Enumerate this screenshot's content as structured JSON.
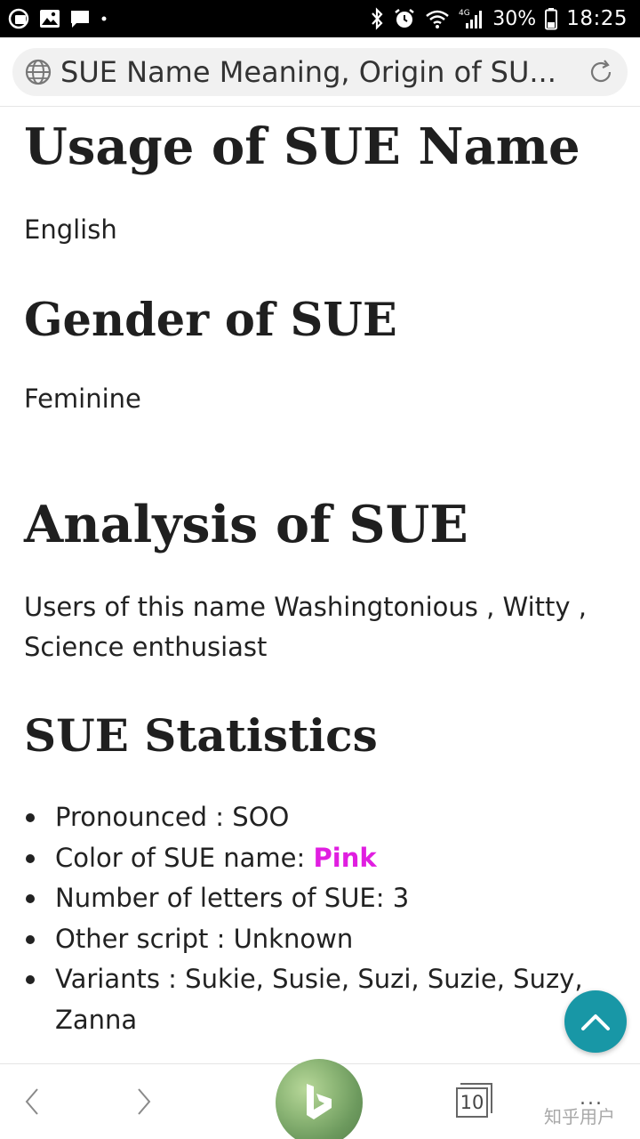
{
  "status_bar": {
    "battery": "30%",
    "time": "18:25",
    "network": "4G",
    "icons": [
      "app-icon",
      "image-icon",
      "message-icon",
      "dot-icon",
      "bluetooth-icon",
      "alarm-icon",
      "wifi-icon",
      "signal-icon",
      "battery-icon"
    ]
  },
  "address_bar": {
    "title": "SUE Name Meaning, Origin of SU...",
    "left_icon": "globe-icon",
    "right_icon": "refresh-icon"
  },
  "content": {
    "usage_heading": "Usage of SUE Name",
    "usage_text": "English",
    "gender_heading": "Gender of SUE",
    "gender_text": "Feminine",
    "analysis_heading": "Analysis of SUE",
    "analysis_text": "Users of this name Washingtonious , Witty , Science enthusiast",
    "stats_heading": "SUE Statistics",
    "stats": {
      "pronounced": "Pronounced : SOO",
      "color_label": "Color of SUE name: ",
      "color_value": "Pink",
      "letters": "Number of letters of SUE: 3",
      "other_script": "Other script : Unknown",
      "variants": "Variants : Sukie, Susie, Suzi, Suzie, Suzy, Zanna"
    }
  },
  "colors": {
    "pink": "#e01ee0",
    "fab": "#1897a6"
  },
  "bottom_nav": {
    "tab_count": "10",
    "watermark": "知乎用户",
    "more": "..."
  }
}
